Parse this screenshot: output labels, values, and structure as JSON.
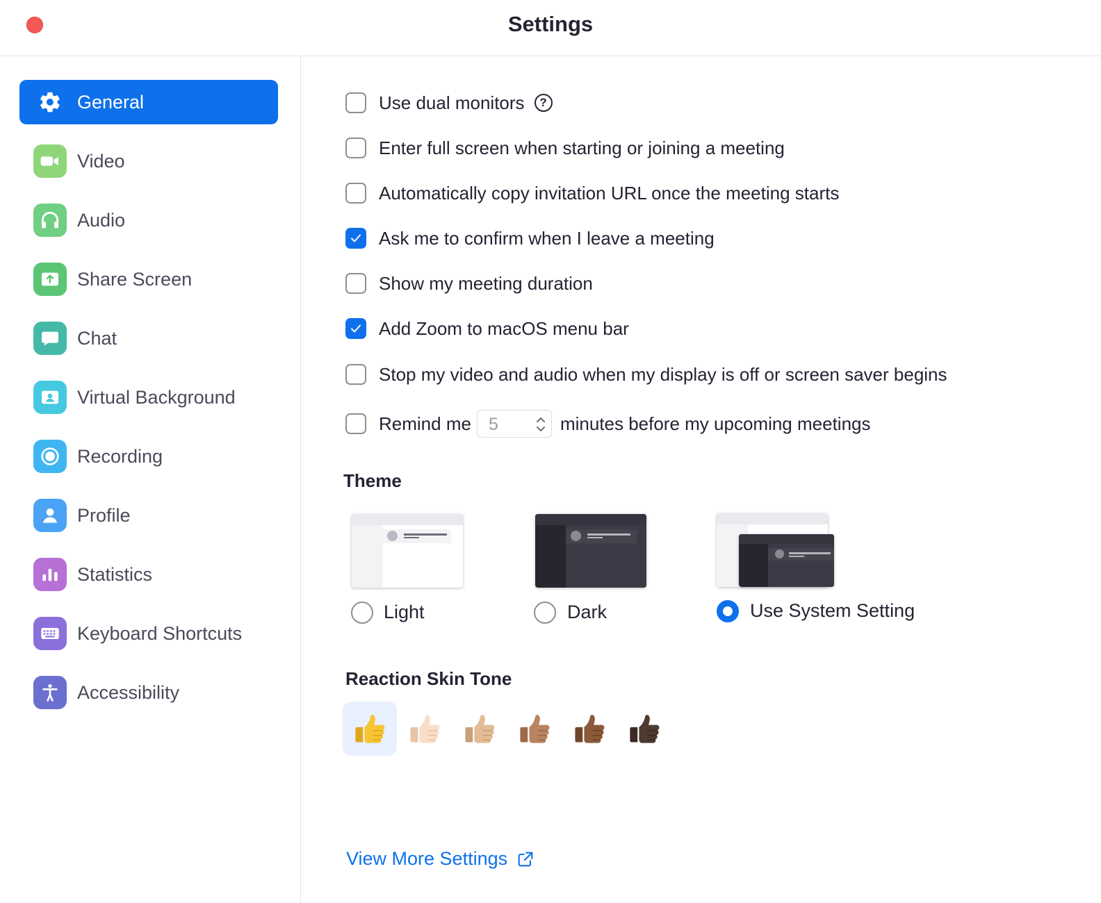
{
  "window": {
    "title": "Settings"
  },
  "colors": {
    "accent": "#0e71eb",
    "close": "#f25a55"
  },
  "sidebar": {
    "items": [
      {
        "label": "General",
        "icon": "gear-icon",
        "active": true
      },
      {
        "label": "Video",
        "icon": "video-camera-icon",
        "color": "#8fd67a"
      },
      {
        "label": "Audio",
        "icon": "headphones-icon",
        "color": "#6fcf82"
      },
      {
        "label": "Share Screen",
        "icon": "share-screen-icon",
        "color": "#5cc574"
      },
      {
        "label": "Chat",
        "icon": "chat-bubble-icon",
        "color": "#45b9a8"
      },
      {
        "label": "Virtual Background",
        "icon": "person-portrait-icon",
        "color": "#45c9e0"
      },
      {
        "label": "Recording",
        "icon": "record-icon",
        "color": "#3fb6f2"
      },
      {
        "label": "Profile",
        "icon": "person-icon",
        "color": "#4aa3f5"
      },
      {
        "label": "Statistics",
        "icon": "bar-chart-icon",
        "color": "#b770d6"
      },
      {
        "label": "Keyboard Shortcuts",
        "icon": "keyboard-icon",
        "color": "#8b70dc"
      },
      {
        "label": "Accessibility",
        "icon": "accessibility-icon",
        "color": "#6b6fcf"
      }
    ]
  },
  "general": {
    "options": [
      {
        "label": "Use dual monitors",
        "checked": false,
        "help": "?"
      },
      {
        "label": "Enter full screen when starting or joining a meeting",
        "checked": false
      },
      {
        "label": "Automatically copy invitation URL once the meeting starts",
        "checked": false
      },
      {
        "label": "Ask me to confirm when I leave a meeting",
        "checked": true
      },
      {
        "label": "Show my meeting duration",
        "checked": false
      },
      {
        "label": "Add Zoom to macOS menu bar",
        "checked": true
      },
      {
        "label": "Stop my video and audio when my display is off or screen saver begins",
        "checked": false
      }
    ],
    "remind": {
      "label_before": "Remind me",
      "minutes": "5",
      "label_after": "minutes before my upcoming meetings",
      "checked": false
    },
    "theme": {
      "title": "Theme",
      "options": [
        {
          "label": "Light",
          "selected": false
        },
        {
          "label": "Dark",
          "selected": false
        },
        {
          "label": "Use System Setting",
          "selected": true
        }
      ]
    },
    "skin_tone": {
      "title": "Reaction Skin Tone",
      "tones": [
        {
          "name": "default",
          "fill": "#f7c433",
          "shade": "#e2a51c",
          "selected": true
        },
        {
          "name": "light",
          "fill": "#f9dec8",
          "shade": "#e8c4a7"
        },
        {
          "name": "medium-light",
          "fill": "#e2bc94",
          "shade": "#c9a077"
        },
        {
          "name": "medium",
          "fill": "#b98461",
          "shade": "#9b6a4a"
        },
        {
          "name": "medium-dark",
          "fill": "#8a5a3a",
          "shade": "#6e4529"
        },
        {
          "name": "dark",
          "fill": "#4f3a31",
          "shade": "#3a2a23"
        }
      ]
    },
    "more_settings": "View More Settings"
  }
}
